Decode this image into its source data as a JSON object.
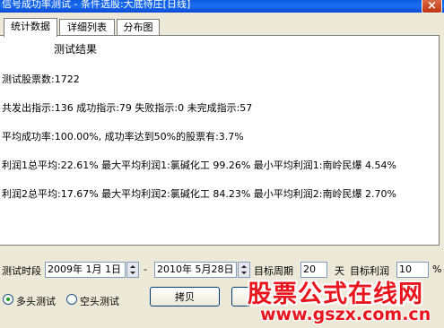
{
  "window": {
    "title": "信号成功率测试 - 条件选股:大底待庄[日线]",
    "close_label": "×"
  },
  "tabs": [
    {
      "label": "统计数据",
      "active": true
    },
    {
      "label": "详细列表",
      "active": false
    },
    {
      "label": "分布图",
      "active": false
    }
  ],
  "results": {
    "heading": "测试结果",
    "lines": [
      "测试股票数:1722",
      "共发出指示:136 成功指示:79 失败指示:0 未完成指示:57",
      "平均成功率:100.00%, 成功率达到50%的股票有:3.7%",
      "利润1总平均:22.61% 最大平均利润1:氯碱化工 99.26% 最小平均利润1:南岭民爆 4.54%",
      "利润2总平均:17.67% 最大平均利润2:氯碱化工 84.23% 最小平均利润2:南岭民爆 2.70%"
    ]
  },
  "controls": {
    "period_label": "测试时段",
    "start_date": "2009年 1月 1日",
    "separator": "-",
    "end_date": "2010年 5月28日",
    "target_period_label": "目标周期",
    "target_period_value": "20",
    "day_unit": "天",
    "target_profit_label": "目标利润",
    "target_profit_value": "10",
    "percent_unit": "%",
    "radio_long": {
      "label": "多头测试",
      "checked": true
    },
    "radio_short": {
      "label": "空头测试",
      "checked": false
    },
    "copy_button": "拷贝"
  },
  "watermark": {
    "title": "股票公式在线网",
    "url": "www.gszx.com.cn"
  }
}
